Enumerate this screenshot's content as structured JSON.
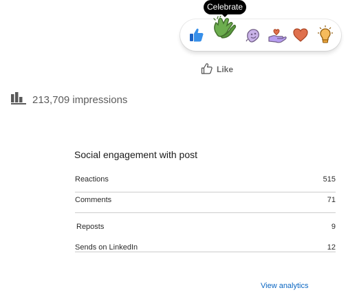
{
  "reactions_popup": {
    "tooltip": "Celebrate",
    "items": [
      "like-icon",
      "celebrate-icon",
      "funny-icon",
      "support-icon",
      "love-icon",
      "insightful-icon"
    ]
  },
  "like_button": {
    "icon": "thumbs-up-outline-icon",
    "label": "Like"
  },
  "impressions": {
    "icon": "bar-chart-icon",
    "text": "213,709 impressions"
  },
  "engagement": {
    "title": "Social engagement with post",
    "rows": [
      {
        "label": "Reactions",
        "value": "515"
      },
      {
        "label": "Comments",
        "value": "71"
      },
      {
        "label": "Reposts",
        "value": "9"
      },
      {
        "label": "Sends on LinkedIn",
        "value": "12"
      }
    ]
  },
  "view_analytics": "View analytics",
  "colors": {
    "like": "#378fe9",
    "celebrate": "#44712e",
    "celebrate_hand": "#6dae4f",
    "funny": "#c9b2e8",
    "support": "#b69df0",
    "love": "#df704d",
    "insightful": "#f5bb5c",
    "link": "#0a66c2"
  }
}
